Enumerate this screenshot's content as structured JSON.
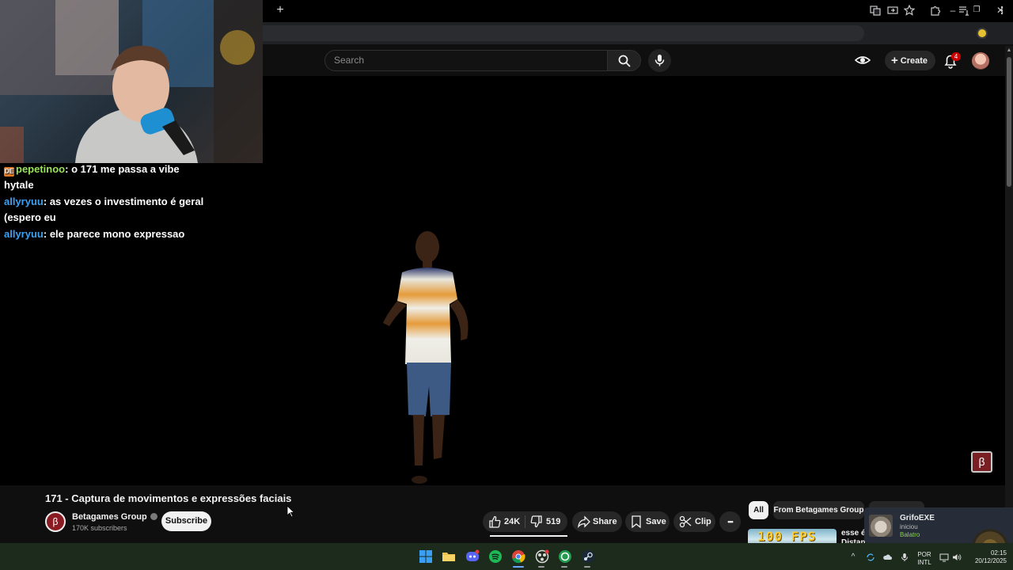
{
  "browser": {
    "new_tab": "+",
    "window_controls": {
      "minimize": "–",
      "maximize": "❐",
      "close": "✕"
    }
  },
  "youtube_header": {
    "search_placeholder": "Search",
    "create_label": "Create",
    "notification_count": "4"
  },
  "video": {
    "title": "171 - Captura de movimentos e expressões faciais",
    "watermark": "β"
  },
  "channel": {
    "logo_letter": "β",
    "name": "Betagames Group",
    "subscribers": "170K subscribers",
    "subscribe_label": "Subscribe"
  },
  "actions": {
    "likes": "24K",
    "dislikes": "519",
    "share": "Share",
    "save": "Save",
    "clip": "Clip",
    "more": "•••"
  },
  "recommendations": {
    "chips": [
      "All",
      "From Betagames Group"
    ],
    "first_thumb_text": "100 FPS",
    "first_title_lines": [
      "esse é",
      "Distan"
    ]
  },
  "stream_chat": {
    "messages": [
      {
        "emote": "DE",
        "user": "pepetinoo",
        "separator": ":",
        "text": " o 171 me passa a vibe",
        "continuation": "hytale"
      },
      {
        "user": "allyryuu",
        "separator": ":",
        "text": " as vezes o investimento é geral",
        "continuation": "(espero eu"
      },
      {
        "user": "allyryuu",
        "separator": ":",
        "text": " ele parece mono expressao"
      }
    ]
  },
  "steam_toast": {
    "name": "GrifoEXE",
    "status": "iniciou",
    "game": "Balatro"
  },
  "taskbar": {
    "lang_top": "POR",
    "lang_bottom": "INTL",
    "time": "02:15",
    "date": "20/12/2025"
  },
  "colors": {
    "youtube_bg": "#0f0f0f",
    "chat_user_green": "#9be35f",
    "chat_user_blue": "#3ea0f0",
    "notification_red": "#cc0000",
    "channel_brand": "#8b1b22",
    "steam_game_green": "#8bd24f"
  }
}
